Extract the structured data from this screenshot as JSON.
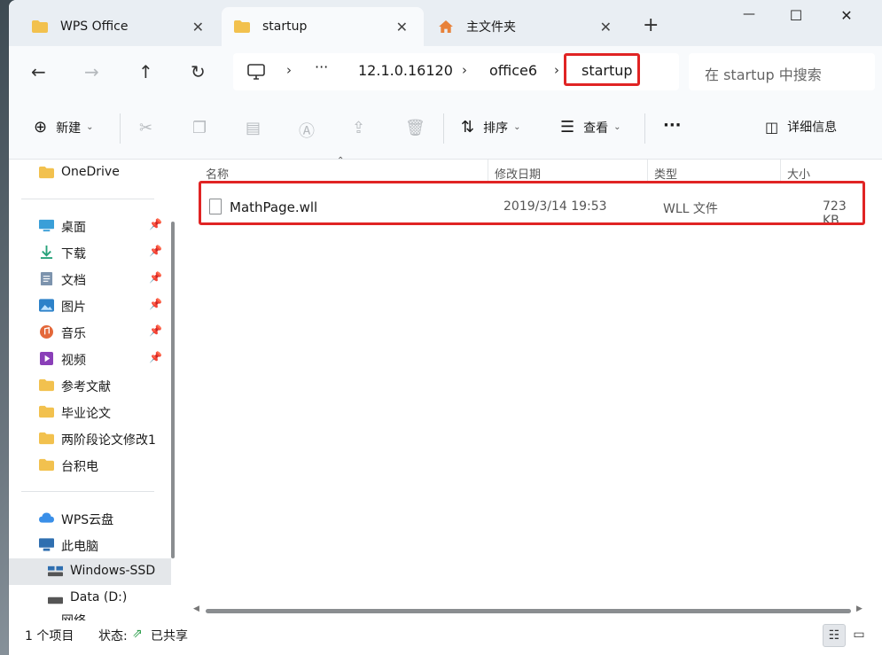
{
  "tabs": [
    {
      "label": "WPS Office",
      "icon": "folder-icon"
    },
    {
      "label": "startup",
      "icon": "folder-icon"
    },
    {
      "label": "主文件夹",
      "icon": "home-icon"
    }
  ],
  "window_controls": {
    "minimize": "—",
    "maximize": "☐",
    "close": "✕"
  },
  "address": {
    "crumbs": [
      "12.1.0.16120",
      "office6",
      "startup"
    ],
    "overflow": "···",
    "search_placeholder": "在 startup 中搜索"
  },
  "toolbar": {
    "new_label": "新建",
    "sort_label": "排序",
    "view_label": "查看",
    "more_label": "···",
    "details_label": "详细信息"
  },
  "sidebar": {
    "top": [
      {
        "label": "OneDrive"
      }
    ],
    "quick": [
      {
        "label": "桌面",
        "pinned": true
      },
      {
        "label": "下载",
        "pinned": true
      },
      {
        "label": "文档",
        "pinned": true
      },
      {
        "label": "图片",
        "pinned": true
      },
      {
        "label": "音乐",
        "pinned": true
      },
      {
        "label": "视频",
        "pinned": true
      },
      {
        "label": "参考文献",
        "pinned": false
      },
      {
        "label": "毕业论文",
        "pinned": false
      },
      {
        "label": "两阶段论文修改1",
        "pinned": false
      },
      {
        "label": "台积电",
        "pinned": false
      }
    ],
    "places": [
      {
        "label": "WPS云盘"
      },
      {
        "label": "此电脑"
      },
      {
        "label": "Windows-SSD"
      },
      {
        "label": "Data (D:)"
      },
      {
        "label": "网络"
      }
    ]
  },
  "columns": {
    "name": "名称",
    "modified": "修改日期",
    "type": "类型",
    "size": "大小"
  },
  "files": [
    {
      "name": "MathPage.wll",
      "modified": "2019/3/14 19:53",
      "type": "WLL 文件",
      "size": "723 KB"
    }
  ],
  "status": {
    "count": "1 个项目",
    "state_label": "状态:",
    "state_value": "已共享"
  },
  "colors": {
    "highlight": "#e02424",
    "folder": "#f2c14e",
    "accent": "#0067c0"
  }
}
